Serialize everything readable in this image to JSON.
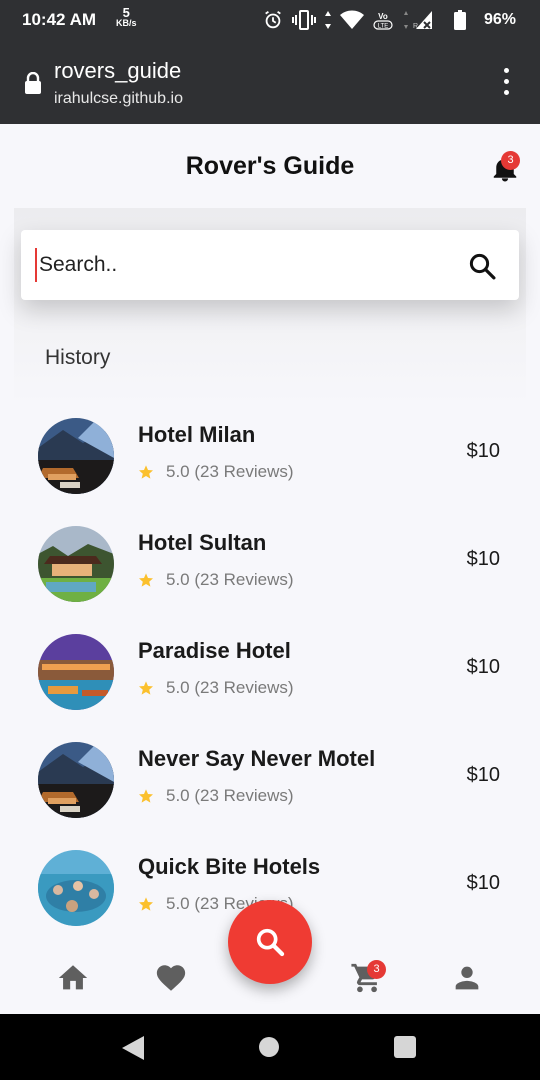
{
  "status_bar": {
    "time": "10:42 AM",
    "speed_value": "5",
    "speed_unit": "KB/s",
    "battery": "96%"
  },
  "browser": {
    "page_title": "rovers_guide",
    "domain": "irahulcse.github.io"
  },
  "header": {
    "title": "Rover's Guide",
    "notification_count": "3"
  },
  "search": {
    "placeholder": "Search..",
    "history_label": "History"
  },
  "hotels": [
    {
      "name": "Hotel Milan",
      "rating": "5.0 (23 Reviews)",
      "price": "$10"
    },
    {
      "name": "Hotel Sultan",
      "rating": "5.0 (23 Reviews)",
      "price": "$10"
    },
    {
      "name": "Paradise Hotel",
      "rating": "5.0 (23 Reviews)",
      "price": "$10"
    },
    {
      "name": "Never Say Never Motel",
      "rating": "5.0 (23 Reviews)",
      "price": "$10"
    },
    {
      "name": "Quick Bite Hotels",
      "rating": "5.0 (23 Reviews)",
      "price": "$10"
    }
  ],
  "bottom_nav": {
    "items": [
      "home-icon",
      "heart-icon",
      "search-icon",
      "cart-icon",
      "person-icon"
    ],
    "cart_count": "3"
  },
  "colors": {
    "accent": "#ef3b33",
    "badge": "#e53935",
    "star": "#fbc02d",
    "browser_bar": "#2f3033"
  }
}
